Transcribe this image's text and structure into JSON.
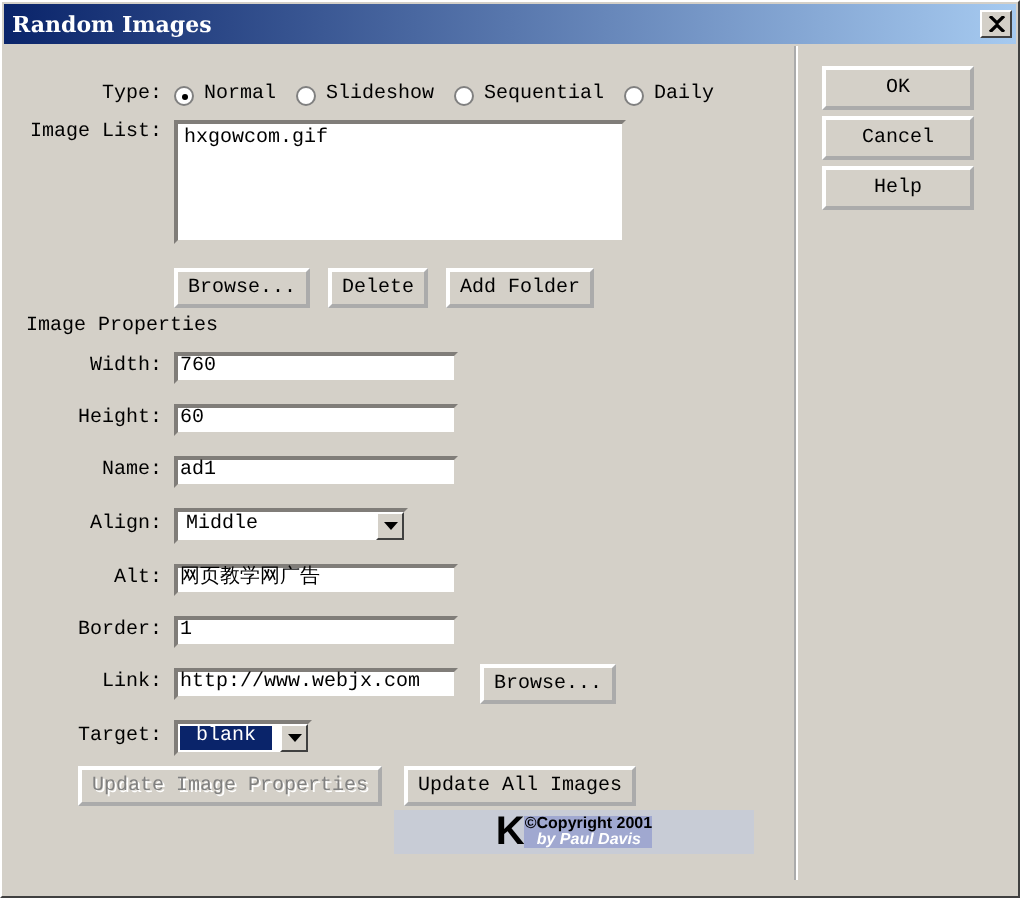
{
  "window": {
    "title": "Random Images"
  },
  "type": {
    "label": "Type:",
    "options": [
      {
        "label": "Normal",
        "selected": true
      },
      {
        "label": "Slideshow",
        "selected": false
      },
      {
        "label": "Sequential",
        "selected": false
      },
      {
        "label": "Daily",
        "selected": false
      }
    ]
  },
  "image_list": {
    "label": "Image List:",
    "items": [
      "hxgowcom.gif"
    ]
  },
  "list_buttons": [
    "Browse...",
    "Delete",
    "Add Folder"
  ],
  "section_title": "Image Properties",
  "fields": [
    {
      "kind": "text",
      "label": "Width:",
      "value": "760"
    },
    {
      "kind": "text",
      "label": "Height:",
      "value": "60"
    },
    {
      "kind": "text",
      "label": "Name:",
      "value": "ad1"
    },
    {
      "kind": "select",
      "label": "Align:",
      "value": "Middle",
      "focused": false
    },
    {
      "kind": "text",
      "label": "Alt:",
      "value": "网页教学网广告"
    },
    {
      "kind": "text",
      "label": "Border:",
      "value": "1"
    },
    {
      "kind": "text",
      "label": "Link:",
      "value": "http://www.webjx.com",
      "button": "Browse..."
    },
    {
      "kind": "select",
      "label": "Target:",
      "value": "blank",
      "focused": true
    }
  ],
  "update_buttons": [
    {
      "label": "Update Image Properties",
      "disabled": true
    },
    {
      "label": "Update All Images",
      "disabled": false
    }
  ],
  "credit": {
    "mark": "K",
    "lines": [
      "©Copyright 2001",
      "by Paul Davis"
    ]
  },
  "dialog_buttons": [
    "OK",
    "Cancel",
    "Help"
  ]
}
